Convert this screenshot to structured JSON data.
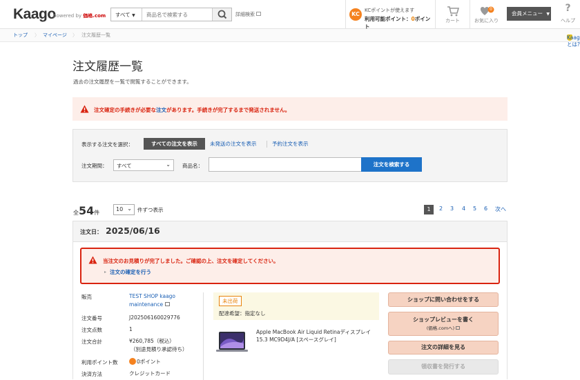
{
  "header": {
    "logo": "Kaago",
    "powered_by_prefix": "powered by",
    "powered_by_brand": "価格.com",
    "search_category": "すべて",
    "search_placeholder": "商品名で検索する",
    "advanced_search": "詳細検索",
    "kc_badge": "KC",
    "kc_line1": "KCポイントが使えます",
    "kc_line2_prefix": "利用可能ポイント：",
    "kc_points": "0",
    "kc_line2_suffix": "ポイント",
    "cart_label": "カート",
    "favorites_label": "お気に入り",
    "favorites_count": "0",
    "member_menu": "会員メニュー",
    "help_label": "ヘルプ"
  },
  "breadcrumb": {
    "items": [
      "トップ",
      "マイページ",
      "注文履歴一覧"
    ],
    "about": "Kaagoとは?"
  },
  "page": {
    "title": "注文履歴一覧",
    "description": "過去の注文履歴を一覧で閲覧することができます。"
  },
  "alert": {
    "text_before": "注文確定の手続きが必要な",
    "link": "注文",
    "text_after": "があります。手続きが完了するまで発送されません。"
  },
  "filter": {
    "select_label": "表示する注文を選択：",
    "all_button": "すべての注文を表示",
    "unshipped_link": "未発送の注文を表示",
    "reserved_link": "予約注文を表示",
    "period_label": "注文期間：",
    "period_value": "すべて",
    "product_label": "商品名：",
    "product_value": "",
    "search_button": "注文を検索する"
  },
  "list": {
    "total_prefix": "全",
    "total": "54",
    "total_suffix": "件",
    "per_page": "10",
    "per_page_suffix": "件ずつ表示",
    "pages": [
      "1",
      "2",
      "3",
      "4",
      "5",
      "6"
    ],
    "current_page": "1",
    "next": "次へ"
  },
  "order": {
    "date_label": "注文日：",
    "date": "2025/06/16",
    "alert_text": "当注文のお見積りが完了しました。ご確認の上、注文を確定してください。",
    "alert_link": "注文の確定を行う",
    "shop_label": "販売",
    "shop_name": "TEST SHOP kaago maintenance",
    "order_no_label": "注文番号",
    "order_no": "J202506160029776",
    "qty_label": "注文点数",
    "qty": "1",
    "total_label": "注文合計",
    "total": "¥260,785（税込）",
    "total_note": "（別途見積り承認待ち）",
    "points_label": "利用ポイント数",
    "points": "0ポイント",
    "payment_label": "決済方法",
    "payment": "クレジットカード",
    "ship_status": "未出荷",
    "ship_hope": "配達希望：指定なし",
    "product_name": "Apple MacBook Air Liquid Retinaディスプレイ 15.3 MC9D4J/A [スペースグレイ]",
    "btn_contact": "ショップに問い合わせをする",
    "btn_review": "ショップレビューを書く",
    "btn_review_sub": "(価格.comへ)",
    "btn_detail": "注文の詳細を見る",
    "btn_receipt": "領収書を発行する"
  }
}
